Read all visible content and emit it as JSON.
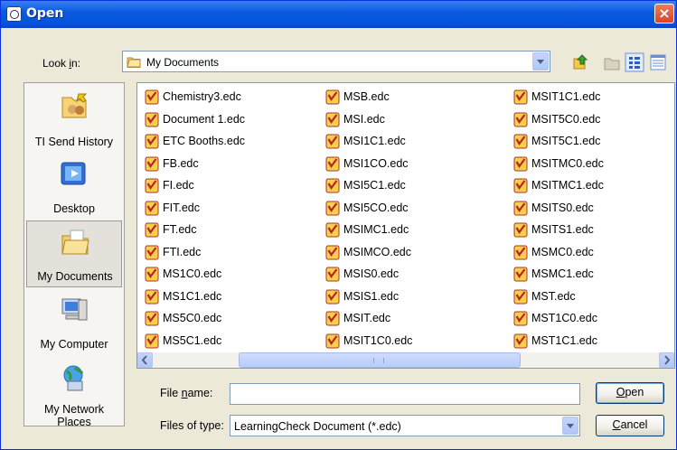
{
  "window": {
    "title": "Open",
    "close_label": "×"
  },
  "lookin": {
    "label_pre": "Look ",
    "label_u": "i",
    "label_post": "n:",
    "value": "My Documents"
  },
  "toolbar": {
    "icons": [
      "up-folder-icon",
      "new-folder-icon",
      "list-view-icon",
      "details-view-icon"
    ]
  },
  "places": [
    {
      "label": "TI Send History",
      "icon": "ti-send-history-icon"
    },
    {
      "label": "Desktop",
      "icon": "desktop-icon"
    },
    {
      "label": "My Documents",
      "icon": "my-documents-icon"
    },
    {
      "label": "My Computer",
      "icon": "my-computer-icon"
    },
    {
      "label": "My Network Places",
      "icon": "my-network-places-icon"
    }
  ],
  "files": {
    "columns": [
      [
        "Chemistry3.edc",
        "Document 1.edc",
        "ETC Booths.edc",
        "FB.edc",
        "FI.edc",
        "FIT.edc",
        "FT.edc",
        "FTI.edc",
        "MS1C0.edc",
        "MS1C1.edc",
        "MS5C0.edc",
        "MS5C1.edc"
      ],
      [
        "MSB.edc",
        "MSI.edc",
        "MSI1C1.edc",
        "MSI1CO.edc",
        "MSI5C1.edc",
        "MSI5CO.edc",
        "MSIMC1.edc",
        "MSIMCO.edc",
        "MSIS0.edc",
        "MSIS1.edc",
        "MSIT.edc",
        "MSIT1C0.edc"
      ],
      [
        "MSIT1C1.edc",
        "MSIT5C0.edc",
        "MSIT5C1.edc",
        "MSITMC0.edc",
        "MSITMC1.edc",
        "MSITS0.edc",
        "MSITS1.edc",
        "MSMC0.edc",
        "MSMC1.edc",
        "MST.edc",
        "MST1C0.edc",
        "MST1C1.edc"
      ]
    ]
  },
  "filename": {
    "label_pre": "File ",
    "label_u": "n",
    "label_post": "ame:",
    "value": "",
    "placeholder": ""
  },
  "filetype": {
    "label": "Files of type:",
    "value": "LearningCheck Document (*.edc)"
  },
  "buttons": {
    "open_u": "O",
    "open_rest": "pen",
    "cancel_u": "C",
    "cancel_rest": "ancel"
  },
  "colors": {
    "titlebar": "#0a5ae0",
    "close": "#d9422c",
    "accent": "#7f9db9"
  }
}
